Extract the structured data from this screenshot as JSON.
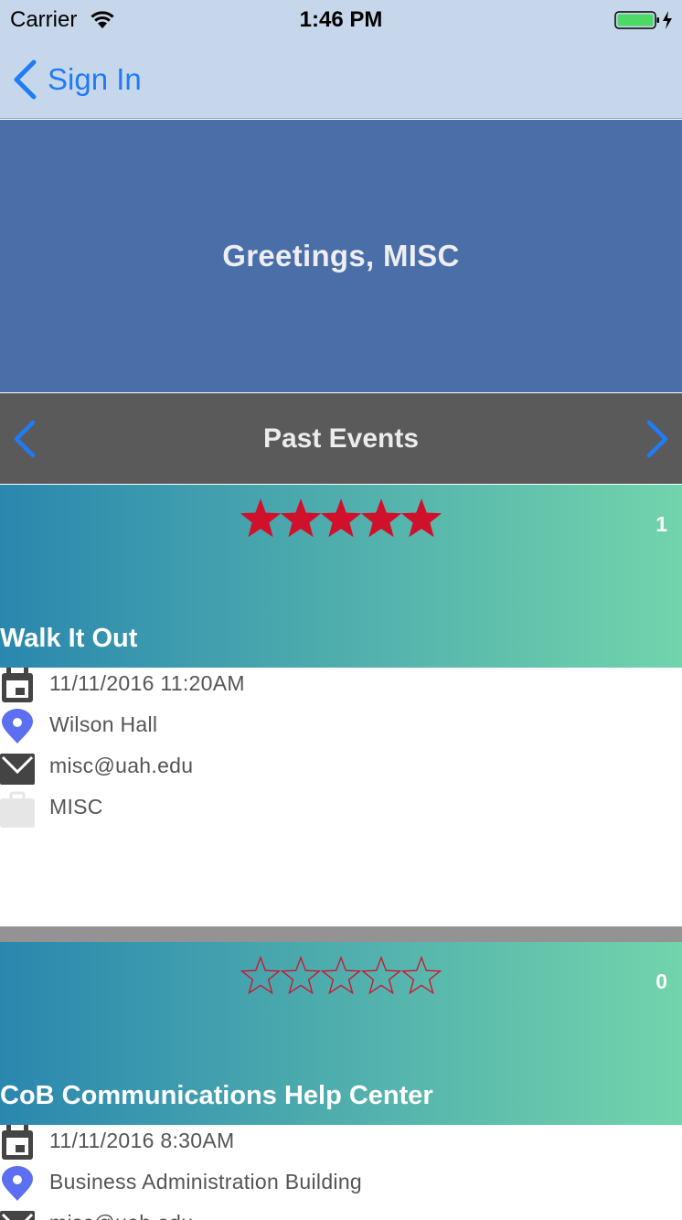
{
  "status_bar": {
    "carrier": "Carrier",
    "time": "1:46 PM"
  },
  "nav": {
    "back_label": "Sign In"
  },
  "greeting": {
    "text": "Greetings, MISC"
  },
  "section": {
    "title": "Past Events"
  },
  "colors": {
    "accent_blue": "#1f7cf6",
    "star_red": "#d0112b",
    "banner_start": "#2a87ae",
    "banner_end": "#72d4ac"
  },
  "events": [
    {
      "title": "Walk It Out",
      "rating_stars_filled": 5,
      "rating_count": "1",
      "datetime": "11/11/2016 11:20AM",
      "location": "Wilson Hall",
      "email": "misc@uah.edu",
      "organization": "MISC"
    },
    {
      "title": "CoB Communications Help Center",
      "rating_stars_filled": 0,
      "rating_count": "0",
      "datetime": "11/11/2016 8:30AM",
      "location": "Business Administration Building",
      "email": "misc@uah.edu"
    }
  ]
}
